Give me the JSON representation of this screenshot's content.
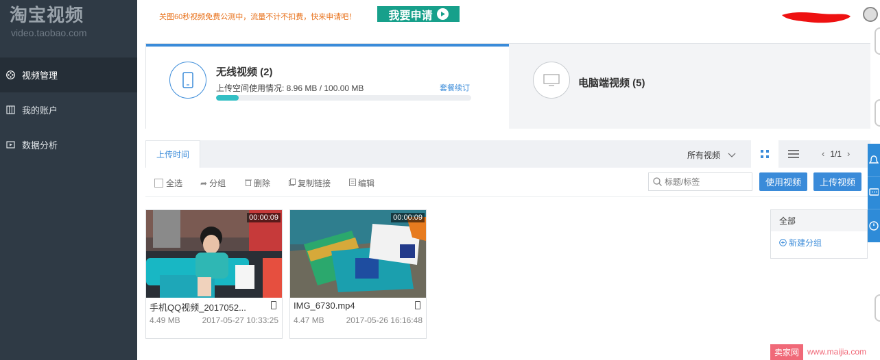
{
  "sidebar": {
    "logo_cn": "淘宝视频",
    "logo_en": "video.taobao.com",
    "items": [
      {
        "label": "视频管理",
        "icon": "film-reel-icon",
        "active": true
      },
      {
        "label": "我的账户",
        "icon": "account-grid-icon",
        "active": false
      },
      {
        "label": "数据分析",
        "icon": "play-box-icon",
        "active": false
      }
    ]
  },
  "topbar": {
    "notice": "关图60秒视频免费公测中，流量不计不扣费，快来申请吧！",
    "apply_label": "我要申请"
  },
  "tabs": {
    "mobile": {
      "title": "无线视频 (2)",
      "usage": "上传空间使用情况: 8.96 MB / 100.00 MB",
      "renew": "套餐续订",
      "progress": 0.0896
    },
    "pc": {
      "title": "电脑端视频 (5)"
    }
  },
  "filterbar": {
    "upload_time_tab": "上传时间",
    "all_videos": "所有视频",
    "page": "1/1"
  },
  "toolbar": {
    "select_all": "全选",
    "group": "分组",
    "delete": "删除",
    "copy_link": "复制链接",
    "edit": "编辑",
    "search_placeholder": "标题/标签",
    "use_video": "使用视频",
    "upload_video": "上传视频"
  },
  "videos": [
    {
      "name": "手机QQ视频_2017052...",
      "duration": "00:00:09",
      "size": "4.49 MB",
      "date": "2017-05-27 10:33:25"
    },
    {
      "name": "IMG_6730.mp4",
      "duration": "00:00:09",
      "size": "4.47 MB",
      "date": "2017-05-26 16:16:48"
    }
  ],
  "groups": {
    "all": "全部",
    "new_group": "新建分组"
  },
  "watermark": {
    "box": "卖家网",
    "url": "www.maijia.com"
  },
  "colors": {
    "accent": "#3a8bd9",
    "apply_green": "#17a08b",
    "sidebar_bg": "#2f3a45",
    "progress_fill": "#33bfc4"
  }
}
